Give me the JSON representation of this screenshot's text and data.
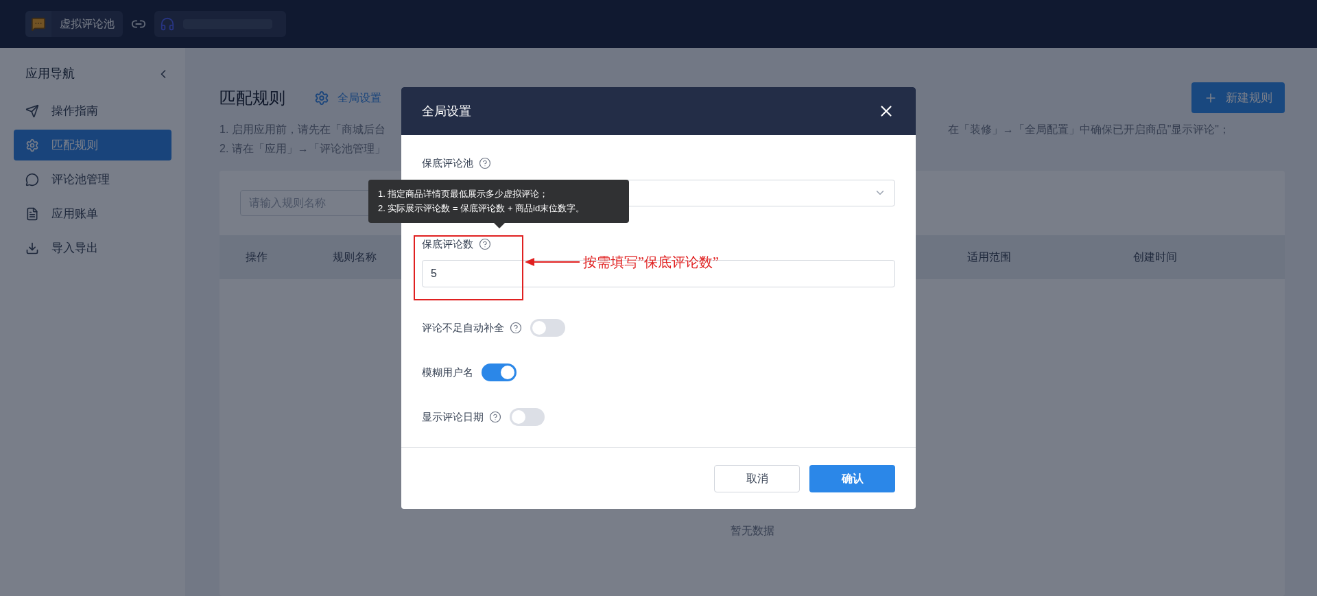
{
  "top_bar": {
    "app_name": "虚拟评论池"
  },
  "sidebar": {
    "title": "应用导航",
    "items": [
      {
        "label": "操作指南",
        "selected": false
      },
      {
        "label": "匹配规则",
        "selected": true
      },
      {
        "label": "评论池管理",
        "selected": false
      },
      {
        "label": "应用账单",
        "selected": false
      },
      {
        "label": "导入导出",
        "selected": false
      }
    ]
  },
  "page": {
    "title": "匹配规则",
    "settings_link": "全局设置",
    "new_button": "新建规则",
    "note_1_start": "1. 启用应用前，请先在「商城后台",
    "note_1_end": "在「装修」→「全局配置」中确保已开启商品\"显示评论\"；",
    "note_2": "2. 请在「应用」→「评论池管理」"
  },
  "filter": {
    "placeholder": "请输入规则名称"
  },
  "table": {
    "columns": [
      "操作",
      "规则名称",
      "适用范围",
      "创建时间"
    ],
    "empty_text": "暂无数据"
  },
  "dialog": {
    "title": "全局设置",
    "fields": [
      {
        "kind": "select",
        "label": "保底评论池",
        "help": true
      },
      {
        "kind": "number",
        "label": "保底评论数",
        "help": true,
        "value": "5"
      },
      {
        "kind": "switch",
        "label": "评论不足自动补全",
        "help": true,
        "on": false
      },
      {
        "kind": "switch",
        "label": "模糊用户名",
        "help": false,
        "on": true
      },
      {
        "kind": "switch",
        "label": "显示评论日期",
        "help": true,
        "on": false
      }
    ],
    "tooltip": [
      "1. 指定商品详情页最低展示多少虚拟评论；",
      "2. 实际展示评论数 = 保底评论数 + 商品id末位数字。"
    ],
    "buttons": [
      {
        "label": "取消",
        "primary": false
      },
      {
        "label": "确认",
        "primary": true
      }
    ]
  },
  "annotation": {
    "text": "按需填写”保底评论数”"
  }
}
